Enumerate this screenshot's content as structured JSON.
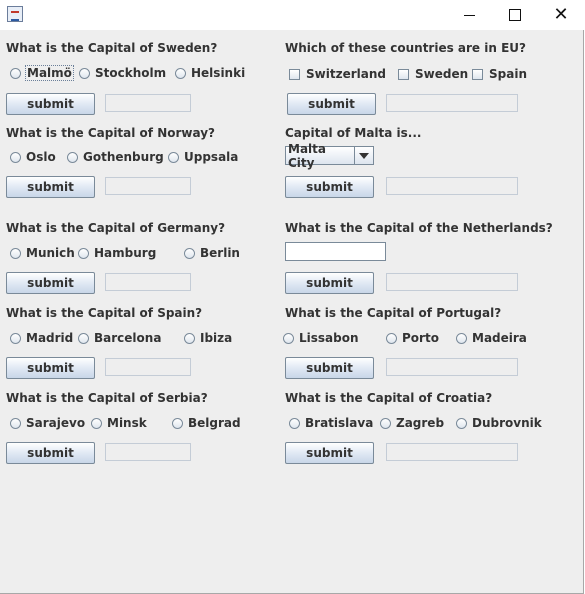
{
  "window": {
    "title": ""
  },
  "left_column": [
    {
      "question": "What is the Capital of Sweden?",
      "options": [
        "Malmö",
        "Stockholm",
        "Helsinki"
      ],
      "button": "submit",
      "result": ""
    },
    {
      "question": "What is the Capital of Norway?",
      "options": [
        "Oslo",
        "Gothenburg",
        "Uppsala"
      ],
      "button": "submit",
      "result": ""
    },
    {
      "question": "What is the Capital of Germany?",
      "options": [
        "Munich",
        "Hamburg",
        "Berlin"
      ],
      "button": "submit",
      "result": ""
    },
    {
      "question": "What is the Capital of Spain?",
      "options": [
        "Madrid",
        "Barcelona",
        "Ibiza"
      ],
      "button": "submit",
      "result": ""
    },
    {
      "question": "What is the Capital of Serbia?",
      "options": [
        "Sarajevo",
        "Minsk",
        "Belgrad"
      ],
      "button": "submit",
      "result": ""
    }
  ],
  "right_column": {
    "eu": {
      "question": "Which of these countries are in EU?",
      "options": [
        "Switzerland",
        "Sweden",
        "Spain"
      ],
      "button": "submit",
      "result": ""
    },
    "malta": {
      "question": "Capital of Malta is...",
      "selected": "Malta City",
      "button": "submit",
      "result": ""
    },
    "netherlands": {
      "question": "What is the Capital of the Netherlands?",
      "input_value": "",
      "button": "submit",
      "result": ""
    },
    "portugal": {
      "question": "What is the Capital of Portugal?",
      "options": [
        "Lissabon",
        "Porto",
        "Madeira"
      ],
      "button": "submit",
      "result": ""
    },
    "croatia": {
      "question": "What is the Capital of Croatia?",
      "options": [
        "Bratislava",
        "Zagreb",
        "Dubrovnik"
      ],
      "button": "submit",
      "result": ""
    }
  }
}
